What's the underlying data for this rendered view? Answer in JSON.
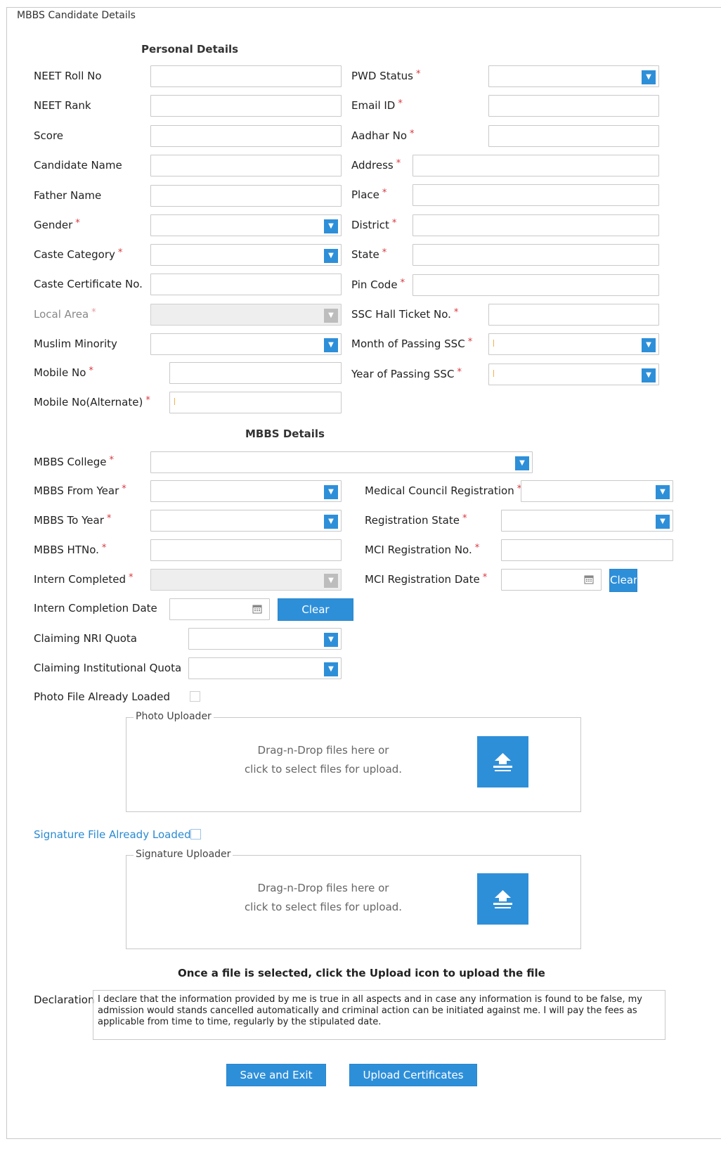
{
  "form": {
    "legend": "MBBS Candidate Details",
    "personal_title": "Personal Details",
    "mbbs_title": "MBBS Details"
  },
  "personal": {
    "neet_roll_no": "NEET Roll No",
    "neet_rank": "NEET Rank",
    "score": "Score",
    "candidate_name": "Candidate Name",
    "father_name": "Father Name",
    "gender": "Gender",
    "caste_category": "Caste Category",
    "caste_certificate_no": "Caste Certificate No.",
    "local_area": "Local Area",
    "muslim_minority": "Muslim Minority",
    "mobile_no": "Mobile No",
    "mobile_no_alternate": "Mobile No(Alternate)",
    "pwd_status": "PWD Status",
    "email_id": "Email ID",
    "aadhar_no": "Aadhar No",
    "address": "Address",
    "place": "Place",
    "district": "District",
    "state": "State",
    "pin_code": "Pin Code",
    "ssc_hall_ticket_no": "SSC Hall Ticket No.",
    "month_of_passing_ssc": "Month of Passing SSC",
    "year_of_passing_ssc": "Year of Passing SSC"
  },
  "mbbs": {
    "mbbs_college": "MBBS College",
    "mbbs_from_year": "MBBS From Year",
    "mbbs_to_year": "MBBS To Year",
    "mbbs_htno": "MBBS HTNo.",
    "intern_completed": "Intern Completed",
    "intern_completion_date": "Intern Completion Date",
    "claiming_nri_quota": "Claiming NRI Quota",
    "claiming_institutional_quota": "Claiming Institutional Quota",
    "photo_file_already_loaded": "Photo File Already Loaded",
    "signature_file_already_loaded": "Signature File Already Loaded",
    "medical_council_registration": "Medical Council Registration",
    "registration_state": "Registration State",
    "mci_registration_no": "MCI Registration No.",
    "mci_registration_date": "MCI Registration Date",
    "clear_label": "Clear"
  },
  "required_mark": "*",
  "uploaders": {
    "photo_legend": "Photo Uploader",
    "signature_legend": "Signature Uploader",
    "drop_line1": "Drag-n-Drop files here or",
    "drop_line2": "click to select files for upload."
  },
  "upload_note": "Once a file is selected, click the Upload icon to upload the file",
  "declaration": {
    "label": "Declaration",
    "text": "I declare that the information provided by me is true in all aspects and in case any information is found to be false, my admission would stands cancelled automatically and criminal action can be initiated against me. I will pay the fees as applicable from time to time, regularly by the stipulated date."
  },
  "actions": {
    "save_and_exit": "Save and Exit",
    "upload_certificates": "Upload Certificates"
  },
  "colors": {
    "accent": "#2e8fd9",
    "required": "#d9363e",
    "link_label": "#2a8ad2"
  },
  "icons": {
    "dropdown": "chevron-down-icon",
    "calendar": "calendar-icon",
    "upload": "upload-icon"
  }
}
